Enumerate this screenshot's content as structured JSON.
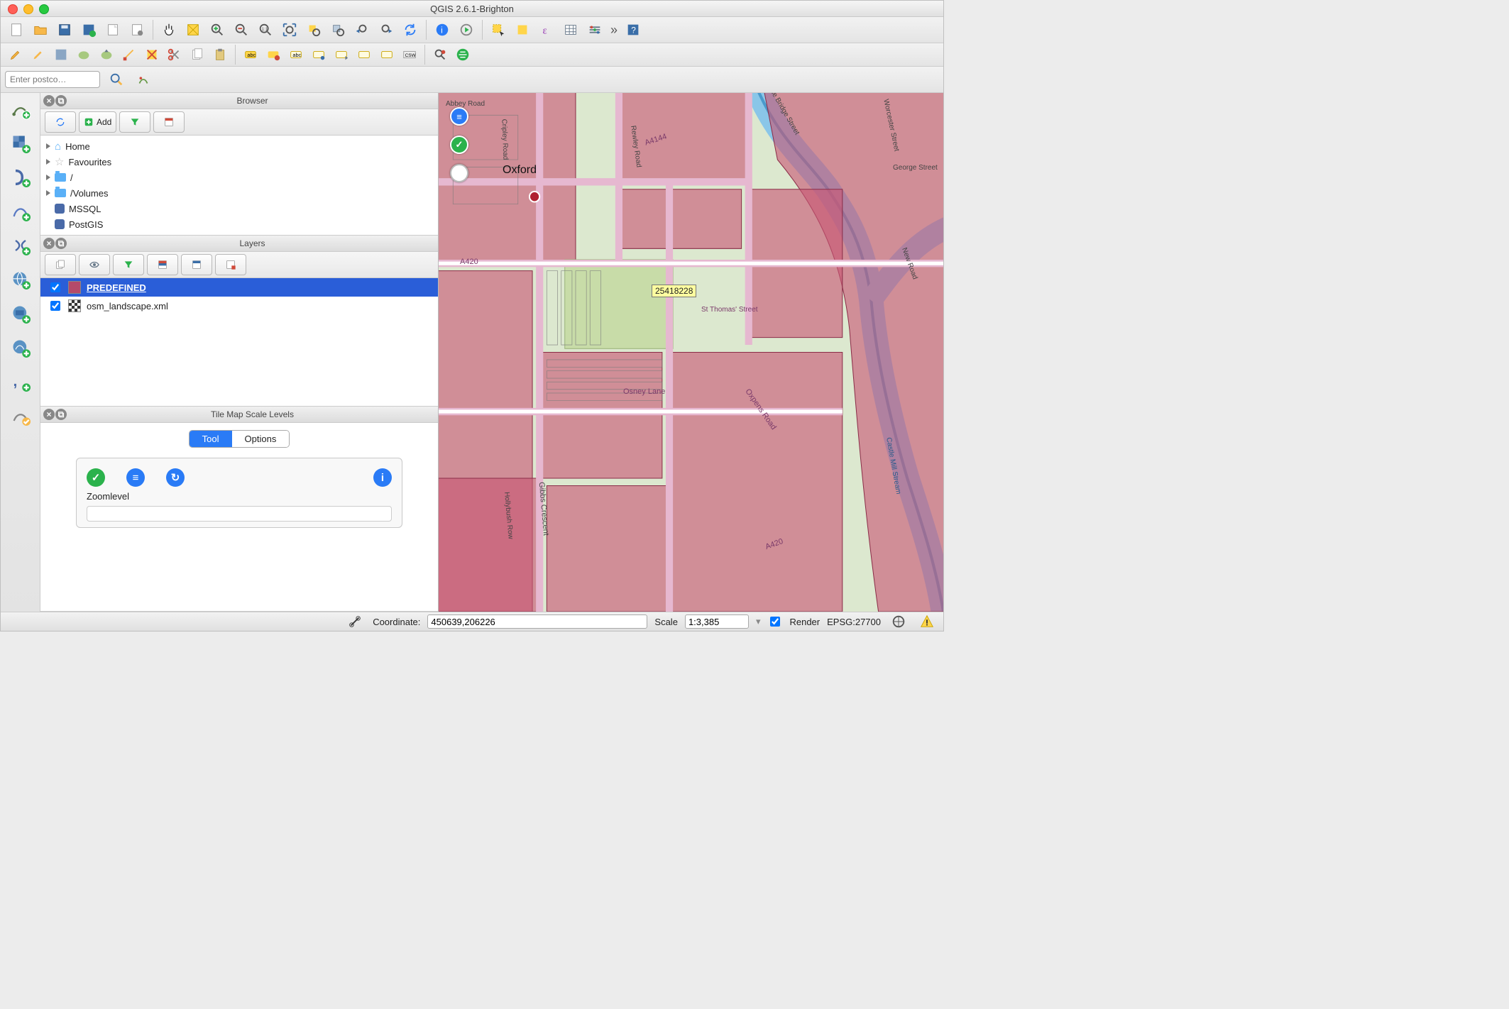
{
  "window": {
    "title": "QGIS 2.6.1-Brighton"
  },
  "postcode": {
    "placeholder": "Enter postco…"
  },
  "browser": {
    "title": "Browser",
    "add_label": "Add",
    "items": [
      {
        "label": "Home",
        "icon": "home",
        "has_children": true
      },
      {
        "label": "Favourites",
        "icon": "star",
        "has_children": true
      },
      {
        "label": "/",
        "icon": "folder",
        "has_children": true
      },
      {
        "label": "/Volumes",
        "icon": "folder",
        "has_children": true
      },
      {
        "label": "MSSQL",
        "icon": "db",
        "has_children": false
      },
      {
        "label": "PostGIS",
        "icon": "db",
        "has_children": false
      }
    ]
  },
  "layers": {
    "title": "Layers",
    "items": [
      {
        "label": "PREDEFINED",
        "checked": true,
        "selected": true,
        "swatch": "solid"
      },
      {
        "label": "osm_landscape.xml",
        "checked": true,
        "selected": false,
        "swatch": "tile"
      }
    ]
  },
  "tms": {
    "title": "Tile Map Scale Levels",
    "tabs": {
      "tool": "Tool",
      "options": "Options",
      "active": "tool"
    },
    "zoom_label": "Zoomlevel"
  },
  "map": {
    "place_label": "Oxford",
    "feature_id_badge": "25418228",
    "roads": {
      "a4144": "A4144",
      "a420_w": "A420",
      "a420_e": "A420",
      "osney": "Osney Lane",
      "gibbs": "Gibbs Crescent",
      "oxpens": "Oxpens Road",
      "stthomas": "St Thomas' Street",
      "cripley": "Cripley Road",
      "rewley": "Rewley Road",
      "mill": "Castle Mill Stream",
      "abbey": "Abbey Road",
      "worcester": "Worcester Street",
      "george": "George Street",
      "newrd": "New Road",
      "hythe": "Hythe Bridge Street",
      "hollybush": "Hollybush Row"
    }
  },
  "status": {
    "coord_label": "Coordinate:",
    "coord_value": "450639,206226",
    "scale_label": "Scale",
    "scale_value": "1:3,385",
    "render_label": "Render",
    "crs_label": "EPSG:27700"
  }
}
